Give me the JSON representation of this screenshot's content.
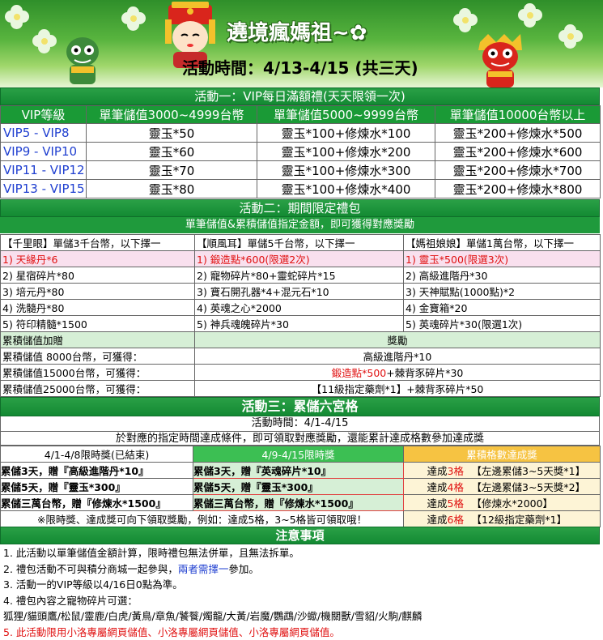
{
  "banner": {
    "title": "遶境瘋媽祖~✿",
    "period": "活動時間：4/13-4/15 (共三天)"
  },
  "act1": {
    "title": "活動一：VIP每日滿額禮(天天限領一次)",
    "headers": [
      "VIP等級",
      "單筆儲值3000~4999台幣",
      "單筆儲值5000~9999台幣",
      "單筆儲值10000台幣以上"
    ],
    "rows": [
      [
        "VIP5 - VIP8",
        "靈玉*50",
        "靈玉*100+修煉水*100",
        "靈玉*200+修煉水*500"
      ],
      [
        "VIP9 - VIP10",
        "靈玉*60",
        "靈玉*100+修煉水*200",
        "靈玉*200+修煉水*600"
      ],
      [
        "VIP11 - VIP12",
        "靈玉*70",
        "靈玉*100+修煉水*300",
        "靈玉*200+修煉水*700"
      ],
      [
        "VIP13 - VIP15",
        "靈玉*80",
        "靈玉*100+修煉水*400",
        "靈玉*200+修煉水*800"
      ]
    ]
  },
  "act2": {
    "title": "活動二：期間限定禮包",
    "subtitle": "單筆儲值&累積儲值指定金額，即可獲得對應獎勵",
    "headers": [
      "【千里眼】單儲3千台幣，以下擇一",
      "【順風耳】單儲5千台幣，以下擇一",
      "【媽祖娘娘】單儲1萬台幣，以下擇一"
    ],
    "rows": [
      [
        "1) 天緣丹*6",
        "1) 鍛造點*600(限選2次)",
        "1) 靈玉*500(限選3次)"
      ],
      [
        "2) 星宿碎片*80",
        "2) 寵物碎片*80+靈蛇碎片*15",
        "2) 高級進階丹*30"
      ],
      [
        "3) 培元丹*80",
        "3) 寶石開孔器*4+混元石*10",
        "3) 天神賦點(1000點)*2"
      ],
      [
        "4) 洗髓丹*80",
        "4) 英魂之心*2000",
        "4) 金寶箱*20"
      ],
      [
        "5) 符印精髓*1500",
        "5) 神兵魂魄碎片*30",
        "5) 英魂碎片*30(限選1次)"
      ]
    ],
    "cum_header": [
      "累積儲值加贈",
      "獎勵"
    ],
    "cum_rows": [
      [
        "累積儲值  8000台幣，可獲得：",
        "高級進階丹*10"
      ],
      [
        "累積儲值15000台幣，可獲得：",
        "鍛造點*500",
        "+棘背豕碎片*30"
      ],
      [
        "累積儲值25000台幣，可獲得：",
        "【11級指定藥劑*1】+棘背豕碎片*50"
      ]
    ]
  },
  "act3": {
    "title": "活動三：累儲六宮格",
    "period": "活動時間：4/1-4/15",
    "desc": "於對應的指定時間達成條件，即可領取對應獎勵，還能累計達成格數參加達成獎",
    "headers": [
      "4/1-4/8限時獎(已結束)",
      "4/9-4/15限時獎",
      "累積格數達成獎"
    ],
    "rows": [
      [
        "累儲3天，贈『高級進階丹*10』",
        "累儲3天，贈『英魂碎片*10』",
        "達成",
        "3格",
        "【左邊累儲3~5天獎*1】"
      ],
      [
        "累儲5天，贈『靈玉*300』",
        "累儲5天，贈『靈玉*300』",
        "達成",
        "4格",
        "【左邊累儲3~5天獎*2】"
      ],
      [
        "累儲三萬台幣，贈『修煉水*1500』",
        "累儲三萬台幣，贈『修煉水*1500』",
        "達成",
        "5格",
        "【修煉水*2000】"
      ],
      [
        "",
        "",
        "達成",
        "6格",
        "【12級指定藥劑*1】"
      ]
    ],
    "note": "※限時獎、達成獎可向下領取獎勵，例如：達成5格，3~5格皆可領取哦！"
  },
  "notes": {
    "title": "注意事項",
    "items": [
      "1. 此活動以單筆儲值金額計算，限時禮包無法併單，且無法拆單。",
      "2. 禮包活動不可與積分商城一起參與，",
      "兩者需擇一",
      "參加。",
      "3. 活動一的VIP等級以4/16日0點為準。",
      "4. 禮包內容之寵物碎片可選：",
      "狐狸/貓頭鷹/松鼠/靈鹿/白虎/黃鳥/章魚/饕餮/燭龍/大黃/岩魔/鸚鵡/沙蠍/機關獸/雪貂/火駒/麒麟",
      "5. 此活動限用小洛專屬網頁儲值、小洛專屬網頁儲值、小洛專屬網頁儲值。"
    ]
  },
  "colors": {
    "green": "#1a9a36",
    "red": "#e01010",
    "blue": "#1f3fd0"
  }
}
